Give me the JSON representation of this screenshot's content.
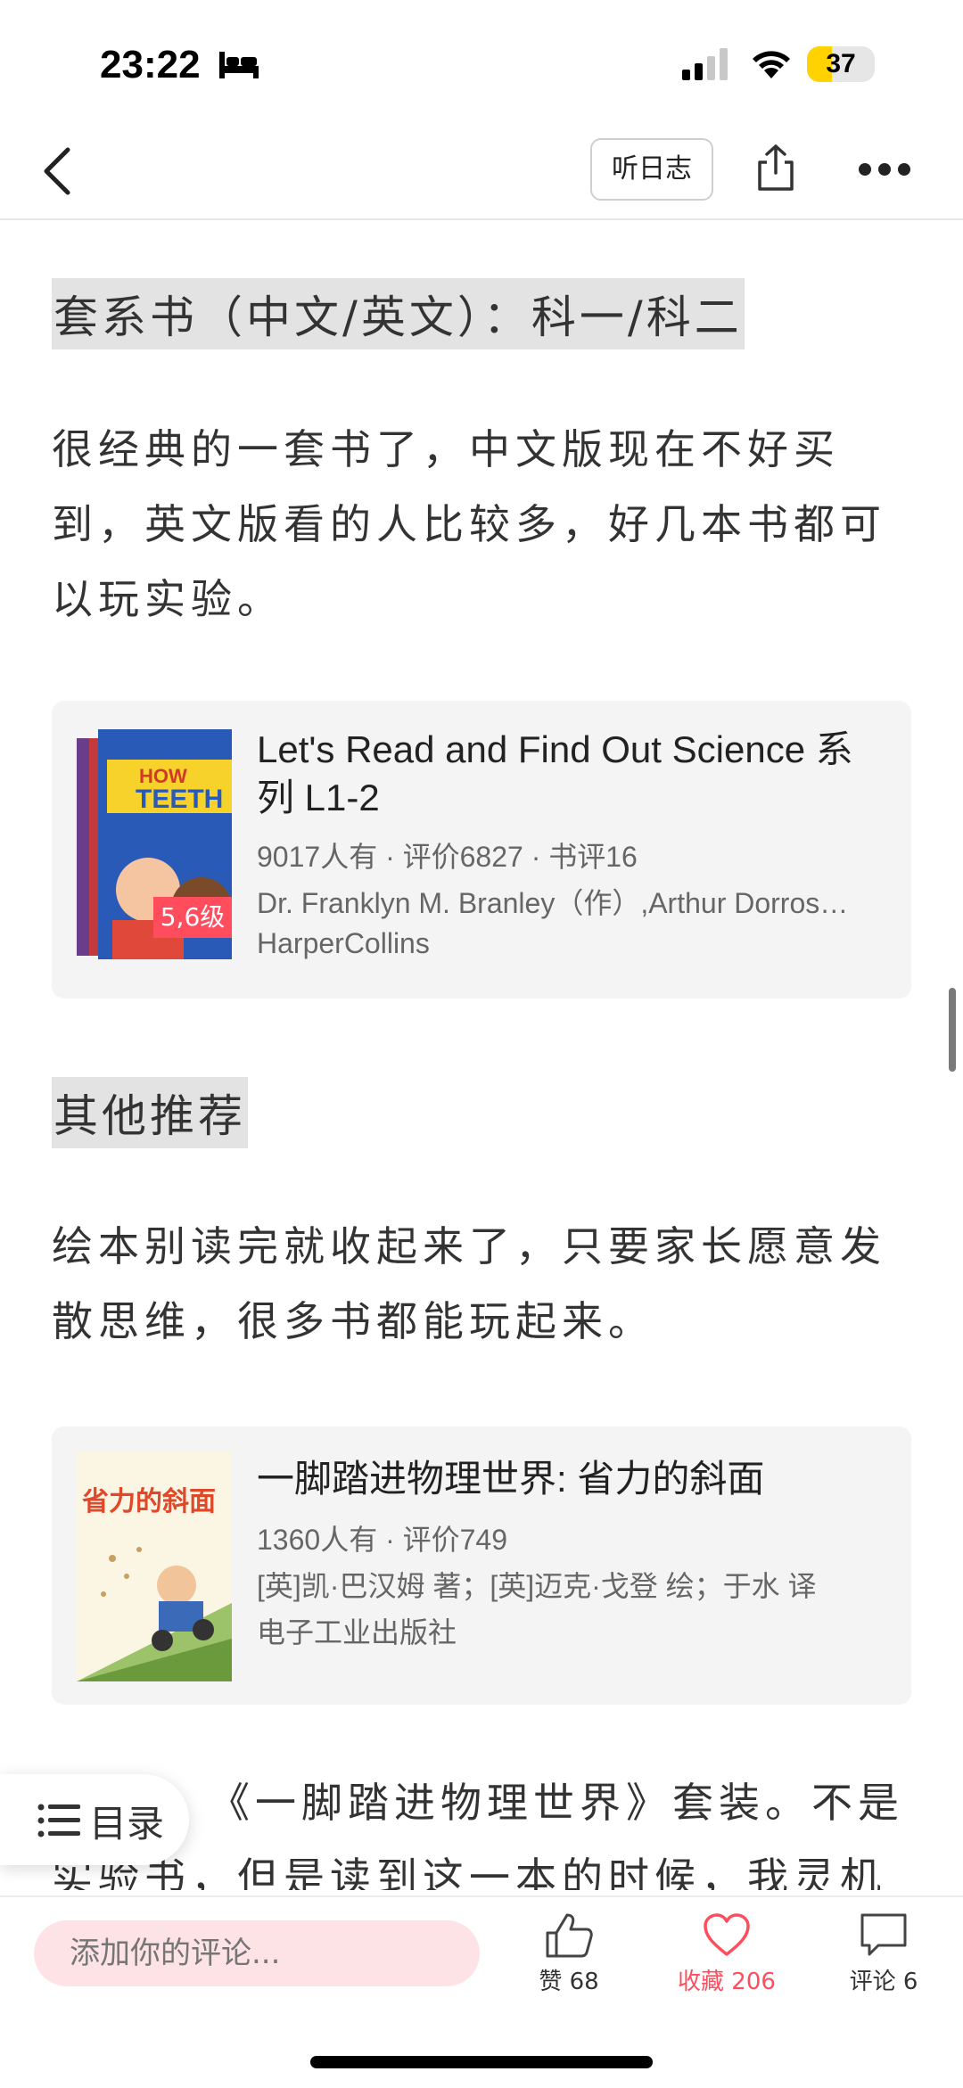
{
  "status_bar": {
    "time": "23:22",
    "battery": "37"
  },
  "nav": {
    "listen_label": "听日志"
  },
  "sections": [
    {
      "heading": "套系书（中文/英文）：科一/科二"
    },
    {
      "paragraph": "很经典的一套书了，中文版现在不好买到，英文版看的人比较多，好几本书都可以玩实验。"
    },
    {
      "heading2": "其他推荐"
    },
    {
      "paragraph2": "绘本别读完就收起来了，只要家长愿意发散思维，很多书都能玩起来。"
    },
    {
      "paragraph3": "《一脚踏进物理世界》套装。不是实验书，但是读到这一本的时候，我灵机一"
    }
  ],
  "books": [
    {
      "title": "Let's Read and Find Out Science 系列 L1-2",
      "stats": "9017人有 · 评价6827 · 书评16",
      "authors": "Dr. Franklyn M. Branley（作）,Arthur Dorros…",
      "publisher": "HarperCollins",
      "badge": "5,6级",
      "cover_text": "HOW TEETH"
    },
    {
      "title": "一脚踏进物理世界: 省力的斜面",
      "stats": "1360人有 · 评价749",
      "authors": "[英]凯·巴汉姆 著；[英]迈克·戈登 绘；于水 译",
      "publisher": "电子工业出版社",
      "cover_text": "省力的斜面"
    }
  ],
  "toc": {
    "label": "目录"
  },
  "bottom_bar": {
    "comment_placeholder": "添加你的评论...",
    "like_label": "赞 68",
    "favorite_label": "收藏 206",
    "comment_label": "评论 6",
    "favorite_color": "#ff4d5e"
  }
}
